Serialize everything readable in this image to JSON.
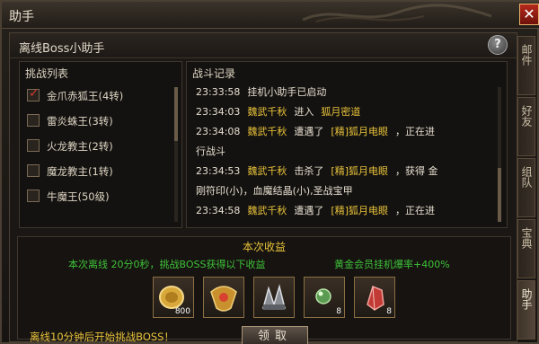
{
  "window": {
    "title": "助手"
  },
  "panel": {
    "title": "离线Boss小助手",
    "help_label": "?"
  },
  "boss_list": {
    "title": "挑战列表",
    "items": [
      {
        "label": "金爪赤狐王(4转)",
        "checked": true
      },
      {
        "label": "雷炎蛛王(3转)",
        "checked": false
      },
      {
        "label": "火龙教主(2转)",
        "checked": false
      },
      {
        "label": "魔龙教主(1转)",
        "checked": false
      },
      {
        "label": "牛魔王(50级)",
        "checked": false
      }
    ]
  },
  "battle_log": {
    "title": "战斗记录",
    "lines": [
      {
        "time": "23:33:58",
        "a": "挂机小助手已启动",
        "b": "",
        "c": "",
        "d": ""
      },
      {
        "time": "23:34:03",
        "a": "魏武千秋",
        "b": "进入",
        "c": "狐月密道",
        "d": ""
      },
      {
        "time": "23:34:08",
        "a": "魏武千秋",
        "b": "遭遇了",
        "c": "[精]狐月电眼",
        "d": "，正在进"
      },
      {
        "time": "",
        "a": "行战斗",
        "b": "",
        "c": "",
        "d": ""
      },
      {
        "time": "23:34:53",
        "a": "魏武千秋",
        "b": "击杀了",
        "c": "[精]狐月电眼",
        "d": "，获得 金"
      },
      {
        "time": "",
        "a": "刚符印(小)，血魔结晶(小),圣战宝甲",
        "b": "",
        "c": "",
        "d": ""
      },
      {
        "time": "23:34:58",
        "a": "魏武千秋",
        "b": "遭遇了",
        "c": "[精]狐月电眼",
        "d": "，正在进"
      }
    ]
  },
  "rewards": {
    "title": "本次收益",
    "summary": "本次离线 20分0秒，挑战BOSS获得以下收益",
    "bonus": "黄金会员挂机爆率+400%",
    "items": [
      {
        "icon": "gold-coin-icon",
        "count": "800"
      },
      {
        "icon": "gold-amulet-icon",
        "count": ""
      },
      {
        "icon": "claw-token-icon",
        "count": ""
      },
      {
        "icon": "green-orb-icon",
        "count": "8"
      },
      {
        "icon": "red-crystal-icon",
        "count": "8"
      }
    ],
    "claim_label": "领取",
    "footnote": "离线10分钟后开始挑战BOSS！"
  },
  "side_tabs": [
    {
      "label": "邮件",
      "active": false
    },
    {
      "label": "好友",
      "active": false
    },
    {
      "label": "组队",
      "active": false
    },
    {
      "label": "宝典",
      "active": false
    },
    {
      "label": "助手",
      "active": true
    }
  ]
}
